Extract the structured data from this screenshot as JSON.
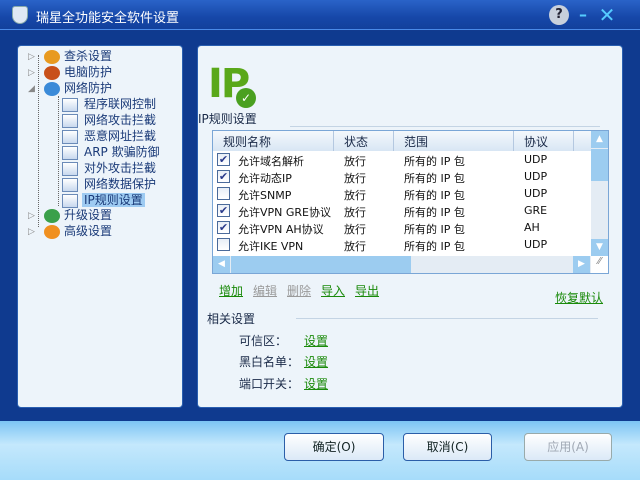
{
  "window": {
    "title": "瑞星全功能安全软件设置",
    "help": "?",
    "minimize": "–",
    "close": "✕"
  },
  "tree": {
    "items": [
      {
        "label": "查杀设置",
        "toggle": "▷",
        "icon": "scan-settings-icon",
        "color": "#e89a20"
      },
      {
        "label": "电脑防护",
        "toggle": "▷",
        "icon": "computer-protection-icon",
        "color": "#c8501a"
      },
      {
        "label": "网络防护",
        "toggle": "◢",
        "icon": "network-protection-icon",
        "color": "#3a8ad8"
      },
      {
        "label": "升级设置",
        "toggle": "▷",
        "icon": "upgrade-settings-icon",
        "color": "#3aa04a"
      },
      {
        "label": "高级设置",
        "toggle": "▷",
        "icon": "advanced-settings-icon",
        "color": "#f09020"
      }
    ],
    "children": [
      "程序联网控制",
      "网络攻击拦截",
      "恶意网址拦截",
      "ARP 欺骗防御",
      "对外攻击拦截",
      "网络数据保护",
      "IP规则设置"
    ],
    "selected": "IP规则设置"
  },
  "main": {
    "logo_text": "IP",
    "section_title": "IP规则设置",
    "columns": [
      "规则名称",
      "状态",
      "范围",
      "协议"
    ],
    "rows": [
      {
        "checked": true,
        "name": "允许域名解析",
        "status": "放行",
        "range": "所有的 IP 包",
        "protocol": "UDP"
      },
      {
        "checked": true,
        "name": "允许动态IP",
        "status": "放行",
        "range": "所有的 IP 包",
        "protocol": "UDP"
      },
      {
        "checked": false,
        "name": "允许SNMP",
        "status": "放行",
        "range": "所有的 IP 包",
        "protocol": "UDP"
      },
      {
        "checked": true,
        "name": "允许VPN GRE协议",
        "status": "放行",
        "range": "所有的 IP 包",
        "protocol": "GRE"
      },
      {
        "checked": true,
        "name": "允许VPN AH协议",
        "status": "放行",
        "range": "所有的 IP 包",
        "protocol": "AH"
      },
      {
        "checked": false,
        "name": "允许IKE VPN",
        "status": "放行",
        "range": "所有的 IP 包",
        "protocol": "UDP"
      }
    ],
    "actions": {
      "add": "增加",
      "edit": "编辑",
      "delete": "删除",
      "import": "导入",
      "export": "导出",
      "restore": "恢复默认"
    },
    "related": {
      "title": "相关设置",
      "items": [
        {
          "label": "可信区：",
          "link": "设置"
        },
        {
          "label": "黑白名单：",
          "link": "设置"
        },
        {
          "label": "端口开关：",
          "link": "设置"
        }
      ]
    }
  },
  "buttons": {
    "ok": "确定(O)",
    "cancel": "取消(C)",
    "apply": "应用(A)"
  },
  "colors": {
    "link": "#1a8a0a",
    "selection": "#9ecbf2",
    "titlebar": "#1647a8"
  }
}
